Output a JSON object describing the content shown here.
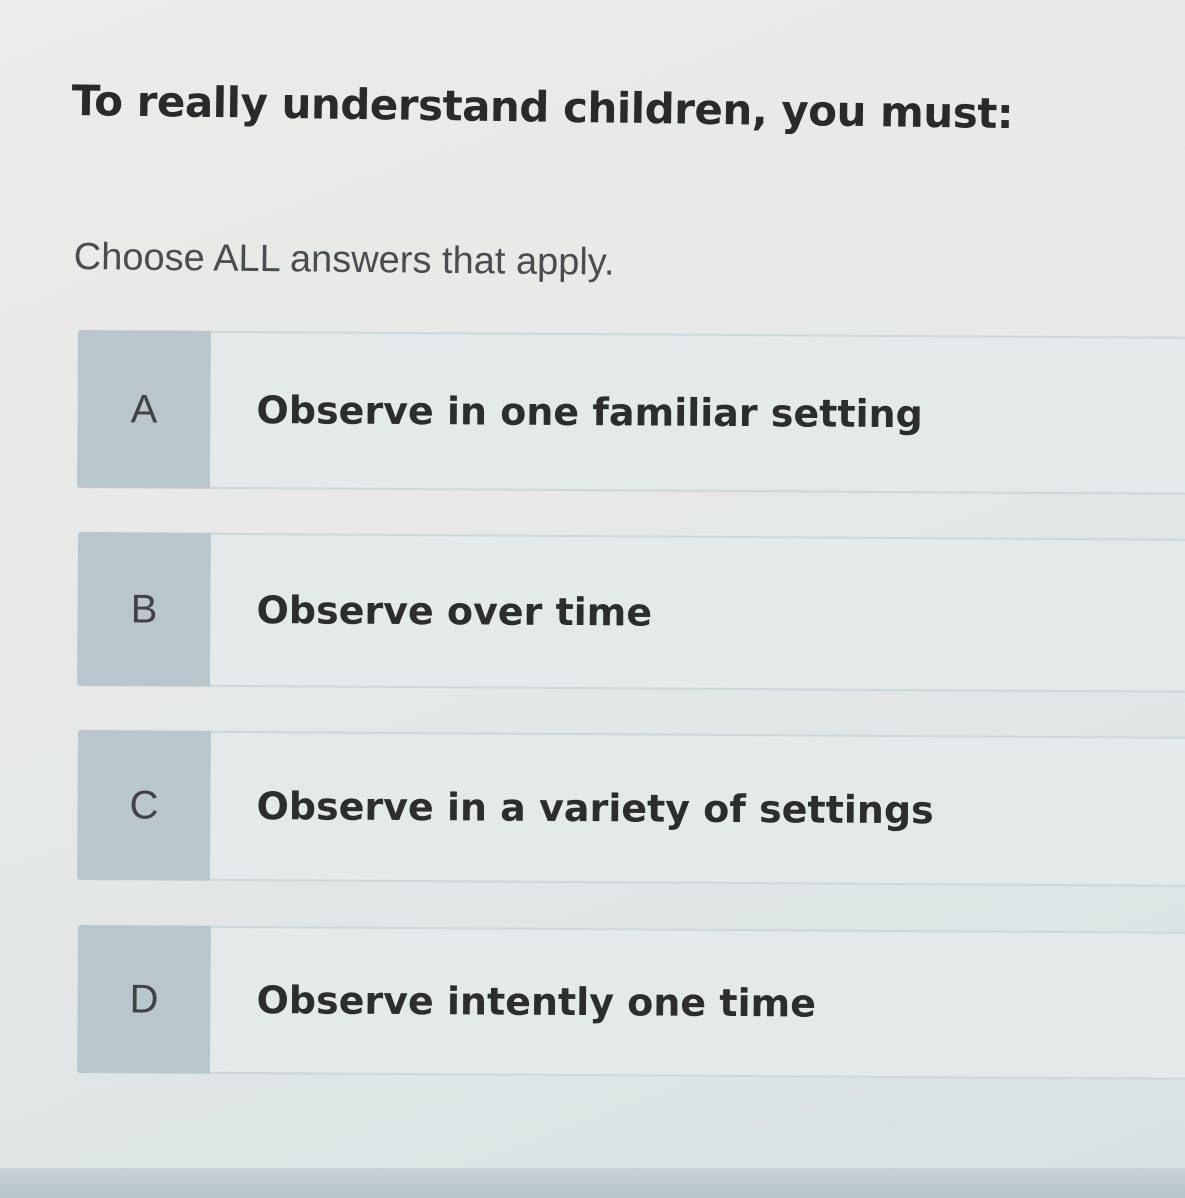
{
  "question": {
    "title": "To really understand children, you must:",
    "instruction": "Choose ALL answers that apply."
  },
  "options": [
    {
      "letter": "A",
      "text": "Observe in one familiar setting"
    },
    {
      "letter": "B",
      "text": "Observe over time"
    },
    {
      "letter": "C",
      "text": "Observe in a variety of settings"
    },
    {
      "letter": "D",
      "text": "Observe intently one time"
    }
  ],
  "colors": {
    "letter_box": "#b9c7cc",
    "option_body": "#e4eaea",
    "text": "#2b2d2f",
    "background": "#e6e9e7"
  }
}
